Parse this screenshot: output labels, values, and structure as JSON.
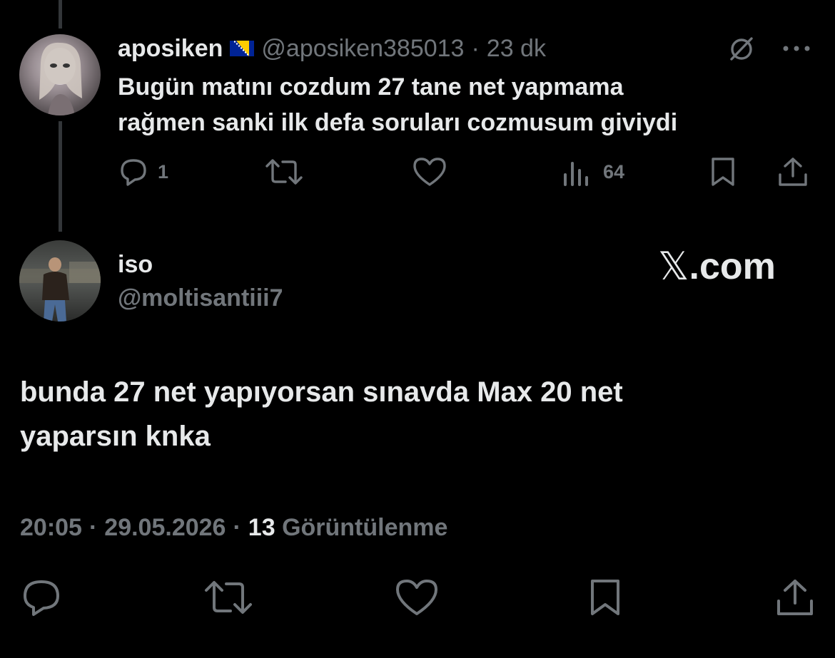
{
  "parent_tweet": {
    "display_name": "aposiken",
    "handle": "@aposiken385013",
    "separator": "·",
    "time_ago": "23 dk",
    "flag": "Bosnia and Herzegovina flag",
    "text_line1": "Bugün matını cozdum 27 tane net yapmama",
    "text_line2": "rağmen sanki ilk defa soruları cozmusum giviydi",
    "reply_count": "1",
    "view_count": "64",
    "icons": {
      "more": "more-icon",
      "grok": "grok-icon",
      "reply": "reply-icon",
      "retweet": "retweet-icon",
      "like": "like-icon",
      "views": "views-icon",
      "bookmark": "bookmark-icon",
      "share": "share-icon"
    }
  },
  "reply_tweet": {
    "display_name": "iso",
    "handle": "@moltisantiii7",
    "text_line1": "bunda 27 net yapıyorsan sınavda Max 20 net",
    "text_line2": "yaparsın knka",
    "time": "20:05",
    "date": "29.05.2026",
    "separator": "·",
    "views_number": "13",
    "views_label": "Görüntülenme"
  },
  "watermark": {
    "logo": "𝕏",
    "text": ".com"
  },
  "colors": {
    "background": "#000000",
    "text": "#e7e9ea",
    "muted": "#71767b",
    "thread_line": "#333639"
  }
}
